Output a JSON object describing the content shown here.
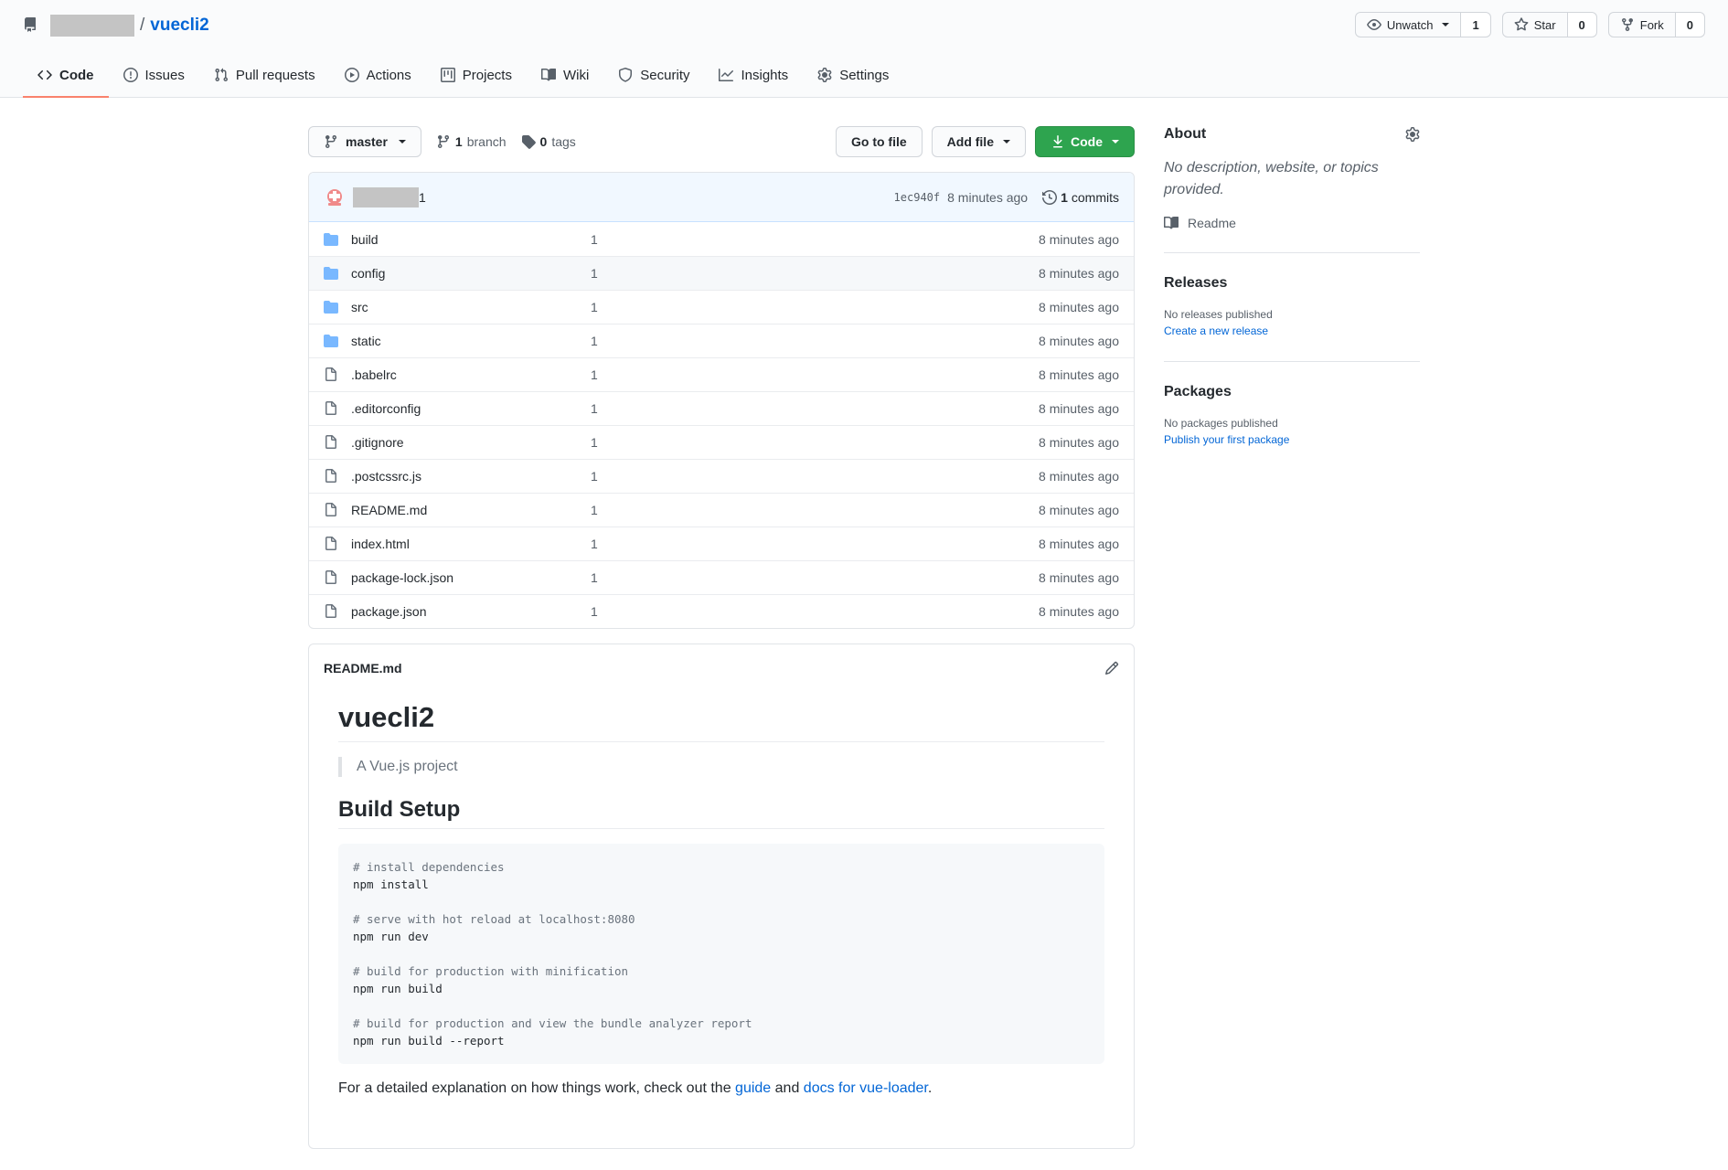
{
  "header": {
    "repo_name": "vuecli2",
    "slash": "/",
    "actions": {
      "watch_label": "Unwatch",
      "watch_count": "1",
      "star_label": "Star",
      "star_count": "0",
      "fork_label": "Fork",
      "fork_count": "0"
    },
    "tabs": [
      {
        "label": "Code",
        "icon": "code-icon",
        "selected": true
      },
      {
        "label": "Issues",
        "icon": "issue-icon"
      },
      {
        "label": "Pull requests",
        "icon": "pull-request-icon"
      },
      {
        "label": "Actions",
        "icon": "play-icon"
      },
      {
        "label": "Projects",
        "icon": "project-icon"
      },
      {
        "label": "Wiki",
        "icon": "book-icon"
      },
      {
        "label": "Security",
        "icon": "shield-icon"
      },
      {
        "label": "Insights",
        "icon": "graph-icon"
      },
      {
        "label": "Settings",
        "icon": "gear-icon"
      }
    ]
  },
  "file_nav": {
    "branch": "master",
    "branch_count": "1",
    "branch_label": "branch",
    "tag_count": "0",
    "tag_label": "tags",
    "go_to_file": "Go to file",
    "add_file": "Add file",
    "code_button": "Code"
  },
  "commit": {
    "message": "1",
    "sha": "1ec940f",
    "age": "8 minutes ago",
    "commits_count": "1",
    "commits_label": "commits"
  },
  "files": [
    {
      "name": "build",
      "type": "dir",
      "message": "1",
      "age": "8 minutes ago"
    },
    {
      "name": "config",
      "type": "dir",
      "message": "1",
      "age": "8 minutes ago"
    },
    {
      "name": "src",
      "type": "dir",
      "message": "1",
      "age": "8 minutes ago"
    },
    {
      "name": "static",
      "type": "dir",
      "message": "1",
      "age": "8 minutes ago"
    },
    {
      "name": ".babelrc",
      "type": "file",
      "message": "1",
      "age": "8 minutes ago"
    },
    {
      "name": ".editorconfig",
      "type": "file",
      "message": "1",
      "age": "8 minutes ago"
    },
    {
      "name": ".gitignore",
      "type": "file",
      "message": "1",
      "age": "8 minutes ago"
    },
    {
      "name": ".postcssrc.js",
      "type": "file",
      "message": "1",
      "age": "8 minutes ago"
    },
    {
      "name": "README.md",
      "type": "file",
      "message": "1",
      "age": "8 minutes ago"
    },
    {
      "name": "index.html",
      "type": "file",
      "message": "1",
      "age": "8 minutes ago"
    },
    {
      "name": "package-lock.json",
      "type": "file",
      "message": "1",
      "age": "8 minutes ago"
    },
    {
      "name": "package.json",
      "type": "file",
      "message": "1",
      "age": "8 minutes ago"
    }
  ],
  "readme": {
    "filename": "README.md",
    "h1": "vuecli2",
    "quote": "A Vue.js project",
    "h2": "Build Setup",
    "code_lines": [
      {
        "text": "# install dependencies",
        "kind": "comment"
      },
      {
        "text": "npm install",
        "kind": "code"
      },
      {
        "text": "",
        "kind": "blank"
      },
      {
        "text": "# serve with hot reload at localhost:8080",
        "kind": "comment"
      },
      {
        "text": "npm run dev",
        "kind": "code"
      },
      {
        "text": "",
        "kind": "blank"
      },
      {
        "text": "# build for production with minification",
        "kind": "comment"
      },
      {
        "text": "npm run build",
        "kind": "code"
      },
      {
        "text": "",
        "kind": "blank"
      },
      {
        "text": "# build for production and view the bundle analyzer report",
        "kind": "comment"
      },
      {
        "text": "npm run build --report",
        "kind": "code"
      }
    ],
    "footer_prefix": "For a detailed explanation on how things work, check out the ",
    "footer_link1": "guide",
    "footer_mid": " and ",
    "footer_link2": "docs for vue-loader",
    "footer_suffix": "."
  },
  "sidebar": {
    "about_title": "About",
    "about_desc": "No description, website, or topics provided.",
    "readme_label": "Readme",
    "releases_title": "Releases",
    "releases_text": "No releases published",
    "releases_link": "Create a new release",
    "packages_title": "Packages",
    "packages_text": "No packages published",
    "packages_link": "Publish your first package"
  },
  "colors": {
    "accent_link": "#0366d6",
    "primary_button": "#2ea44f",
    "selected_tab_underline": "#f9826c",
    "folder_icon": "#79b8ff"
  }
}
